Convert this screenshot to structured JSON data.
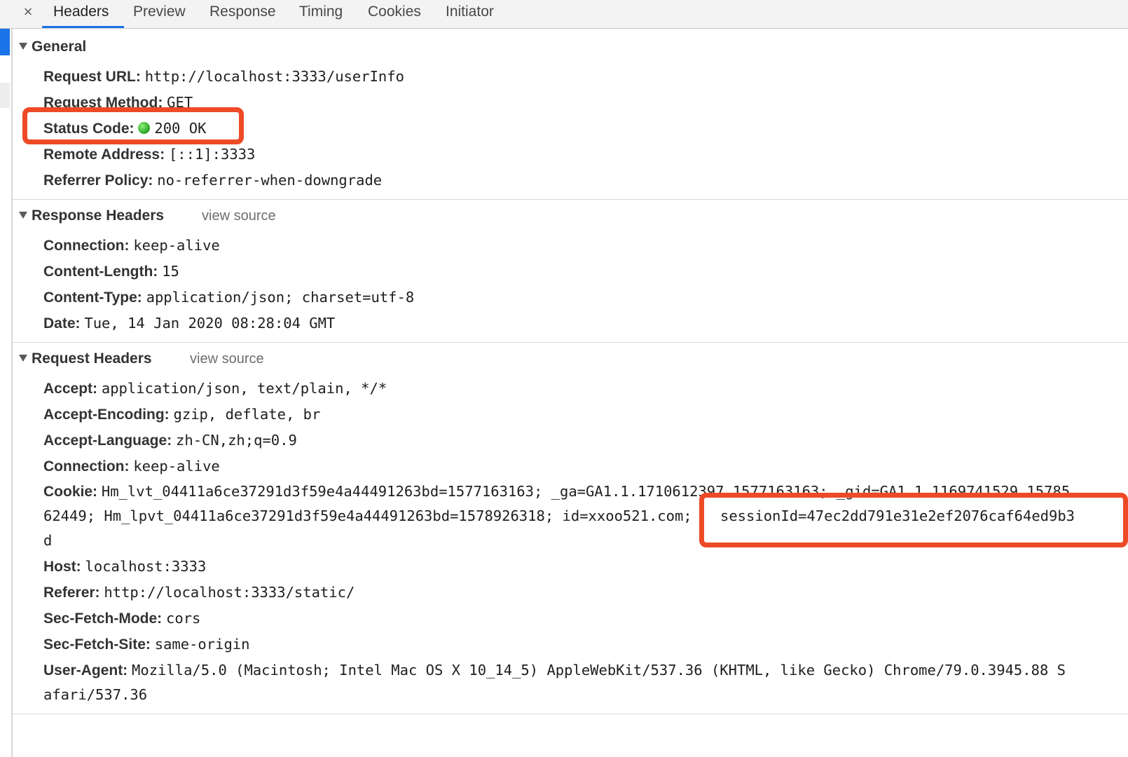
{
  "tabs": {
    "close_glyph": "×",
    "items": [
      "Headers",
      "Preview",
      "Response",
      "Timing",
      "Cookies",
      "Initiator"
    ]
  },
  "general": {
    "title": "General",
    "request_url": {
      "key": "Request URL:",
      "value": "http://localhost:3333/userInfo"
    },
    "request_method": {
      "key": "Request Method:",
      "value": "GET"
    },
    "status_code": {
      "key": "Status Code:",
      "value": "200 OK"
    },
    "remote_address": {
      "key": "Remote Address:",
      "value": "[::1]:3333"
    },
    "referrer_policy": {
      "key": "Referrer Policy:",
      "value": "no-referrer-when-downgrade"
    }
  },
  "response_headers": {
    "title": "Response Headers",
    "view_source": "view source",
    "items": [
      {
        "key": "Connection:",
        "value": "keep-alive"
      },
      {
        "key": "Content-Length:",
        "value": "15"
      },
      {
        "key": "Content-Type:",
        "value": "application/json; charset=utf-8"
      },
      {
        "key": "Date:",
        "value": "Tue, 14 Jan 2020 08:28:04 GMT"
      }
    ]
  },
  "request_headers": {
    "title": "Request Headers",
    "view_source": "view source",
    "accept": {
      "key": "Accept:",
      "value": "application/json, text/plain, */*"
    },
    "accept_encoding": {
      "key": "Accept-Encoding:",
      "value": "gzip, deflate, br"
    },
    "accept_language": {
      "key": "Accept-Language:",
      "value": "zh-CN,zh;q=0.9"
    },
    "connection": {
      "key": "Connection:",
      "value": "keep-alive"
    },
    "cookie": {
      "key": "Cookie:",
      "line1": "Hm_lvt_04411a6ce37291d3f59e4a44491263bd=1577163163; _ga=GA1.1.1710612397.1577163163; _gid=GA1.1.1169741529.15785",
      "line2": "62449; Hm_lpvt_04411a6ce37291d3f59e4a44491263bd=1578926318; id=xxoo521.com;",
      "session": "sessionId=47ec2dd791e31e2ef2076caf64ed9b3",
      "line3": "d"
    },
    "host": {
      "key": "Host:",
      "value": "localhost:3333"
    },
    "referer": {
      "key": "Referer:",
      "value": "http://localhost:3333/static/"
    },
    "sec_fetch_mode": {
      "key": "Sec-Fetch-Mode:",
      "value": "cors"
    },
    "sec_fetch_site": {
      "key": "Sec-Fetch-Site:",
      "value": "same-origin"
    },
    "user_agent": {
      "key": "User-Agent:",
      "line1": "Mozilla/5.0 (Macintosh; Intel Mac OS X 10_14_5) AppleWebKit/537.36 (KHTML, like Gecko) Chrome/79.0.3945.88 S",
      "line2": "afari/537.36"
    }
  },
  "colors": {
    "accent": "#1a73e8",
    "highlight": "#ee4a26",
    "status_ok": "#2ea82a"
  }
}
